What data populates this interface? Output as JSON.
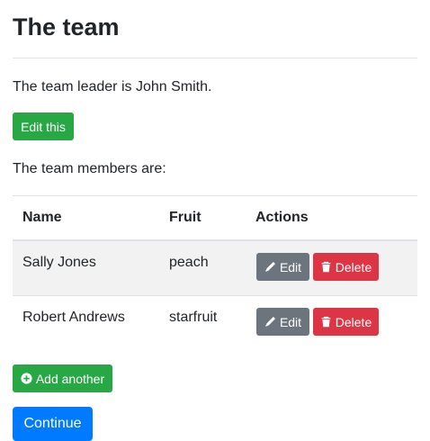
{
  "page": {
    "title": "The team",
    "leader_text": "The team leader is John Smith.",
    "edit_button": "Edit this",
    "members_intro": "The team members are:",
    "add_button": "Add another",
    "continue_button": "Continue"
  },
  "table": {
    "headers": [
      "Name",
      "Fruit",
      "Actions"
    ],
    "rows": [
      {
        "name": "Sally Jones",
        "fruit": "peach",
        "edit": "Edit",
        "delete": "Delete"
      },
      {
        "name": "Robert Andrews",
        "fruit": "starfruit",
        "edit": "Edit",
        "delete": "Delete"
      }
    ]
  },
  "colors": {
    "success": "#28a745",
    "secondary": "#6c757d",
    "danger": "#dc3545",
    "primary": "#007bff"
  },
  "icons": {
    "edit": "pencil-icon",
    "delete": "trash-icon",
    "add": "plus-circle-icon"
  }
}
